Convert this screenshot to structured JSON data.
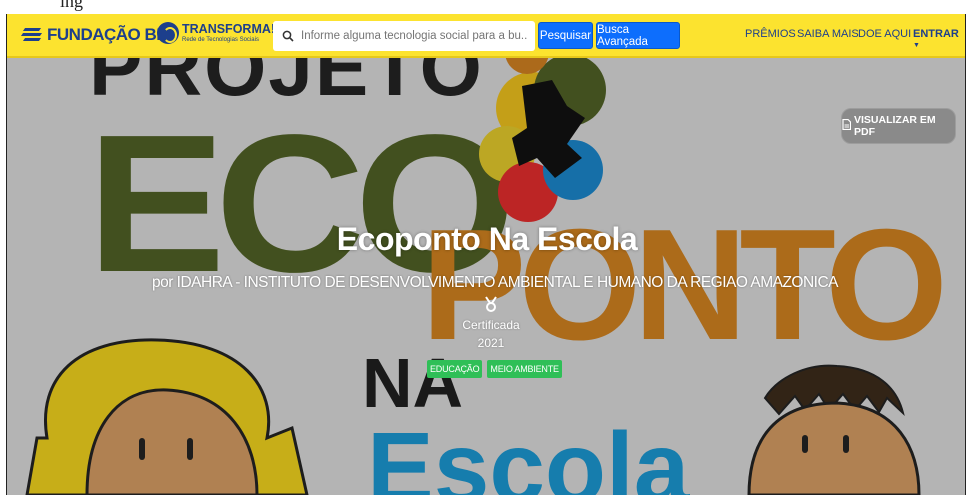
{
  "fragment_text": "ing",
  "navbar": {
    "logo_text": "FUNDAÇÃO BB",
    "transforma_title": "TRANSFORMA!",
    "transforma_subtitle": "Rede de Tecnologias Sociais",
    "search_placeholder": "Informe alguma tecnologia social para a bu...",
    "search_button": "Pesquisar",
    "advanced_button": "Busca Avançada",
    "menu": [
      "PRÊMIOS",
      "SAIBA MAIS",
      "DOE AQUI"
    ],
    "login_label": "ENTRAR",
    "brand_color": "#fce32f",
    "primary_color": "#0d6efd"
  },
  "hero": {
    "background_lettering": {
      "projeto": "PROJETO",
      "eco": "ECO",
      "ponto": "PONTO",
      "na": "NA",
      "escola": "Escola"
    },
    "pdf_button": "VISUALIZAR EM PDF",
    "title": "Ecoponto Na Escola",
    "byline": "por IDAHRA - INSTITUTO DE DESENVOLVIMENTO AMBIENTAL E HUMANO DA REGIAO AMAZONICA",
    "certified_label": "Certificada",
    "certified_year": "2021",
    "tags": [
      "EDUCAÇÃO",
      "MEIO AMBIENTE"
    ],
    "tag_color": "#2fbf57"
  }
}
